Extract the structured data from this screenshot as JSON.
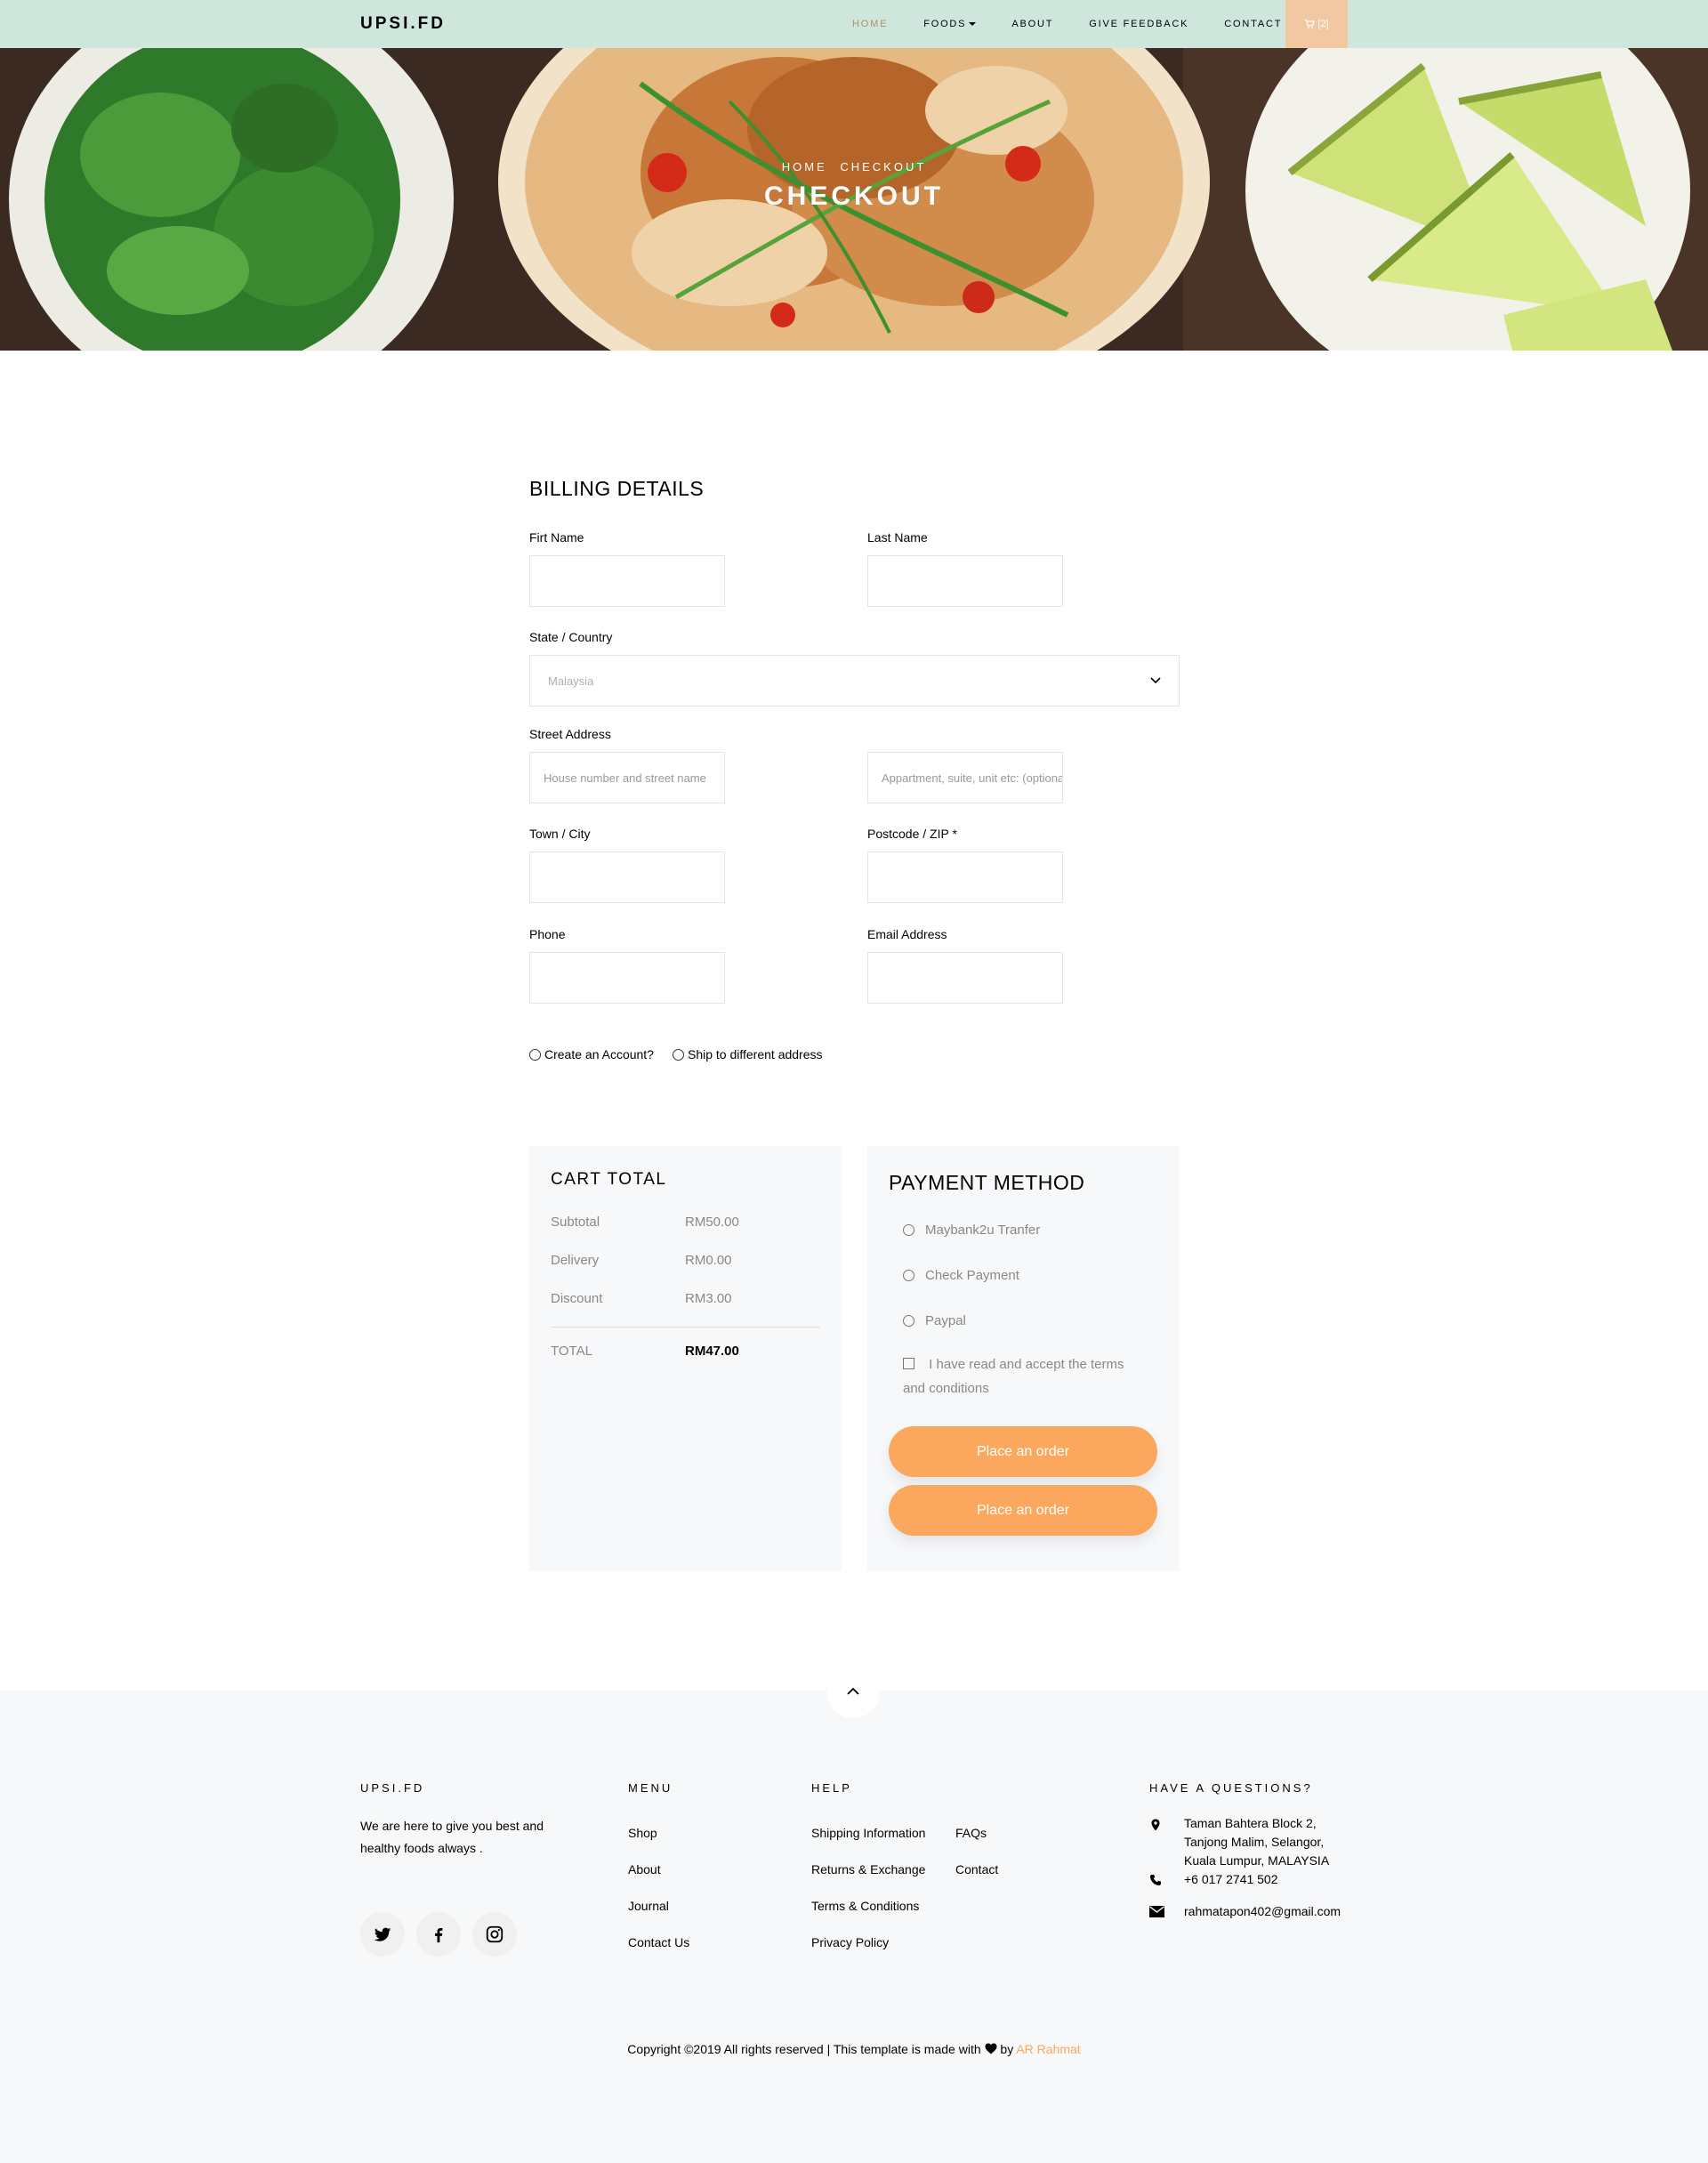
{
  "nav": {
    "brand": "UPSI.FD",
    "items": [
      {
        "label": "HOME",
        "active": true
      },
      {
        "label": "FOODS",
        "dropdown": true
      },
      {
        "label": "ABOUT"
      },
      {
        "label": "GIVE FEEDBACK"
      },
      {
        "label": "CONTACT"
      }
    ],
    "cart_count": "[2]",
    "cart_icon": "cart-icon"
  },
  "hero": {
    "breadcrumb_home": "HOME",
    "breadcrumb_current": "CHECKOUT",
    "title": "CHECKOUT"
  },
  "billing": {
    "title": "BILLING DETAILS",
    "first_name_label": "Firt Name",
    "last_name_label": "Last Name",
    "country_label": "State / Country",
    "country_value": "Malaysia",
    "street_label": "Street Address",
    "street_placeholder": "House number and street name",
    "street2_placeholder": "Appartment, suite, unit etc: (optional)",
    "town_label": "Town / City",
    "postcode_label": "Postcode / ZIP *",
    "phone_label": "Phone",
    "email_label": "Email Address",
    "create_account": "Create an Account?",
    "ship_different": "Ship to different address"
  },
  "cart_total": {
    "title": "CART TOTAL",
    "rows": [
      {
        "label": "Subtotal",
        "value": "RM50.00"
      },
      {
        "label": "Delivery",
        "value": "RM0.00"
      },
      {
        "label": "Discount",
        "value": "RM3.00"
      }
    ],
    "total_label": "TOTAL",
    "total_value": "RM47.00"
  },
  "payment": {
    "title": "PAYMENT METHOD",
    "options": [
      "Maybank2u Tranfer",
      "Check Payment",
      "Paypal"
    ],
    "terms": "I have read and accept the terms and conditions",
    "buttons": [
      "Place an order",
      "Place an order"
    ]
  },
  "footer": {
    "brand_heading": "UPSI.FD",
    "brand_text": "We are here to give you best and healthy foods always .",
    "menu_heading": "MENU",
    "menu": [
      "Shop",
      "About",
      "Journal",
      "Contact Us"
    ],
    "help_heading": "HELP",
    "help_col1": [
      "Shipping Information",
      "Returns & Exchange",
      "Terms & Conditions",
      "Privacy Policy"
    ],
    "help_col2": [
      "FAQs",
      "Contact"
    ],
    "questions_heading": "HAVE A QUESTIONS?",
    "address_lines": [
      "Taman Bahtera Block 2,",
      "Tanjong Malim, Selangor,",
      "Kuala Lumpur, MALAYSIA"
    ],
    "phone": "+6 017 2741 502",
    "email": "rahmatapon402@gmail.com",
    "social_icons": [
      "twitter-icon",
      "facebook-icon",
      "instagram-icon"
    ],
    "copyright_text": "Copyright ©2019 All rights reserved | This template is made with",
    "copyright_by": "by",
    "copyright_author": "AR Rahmat"
  }
}
